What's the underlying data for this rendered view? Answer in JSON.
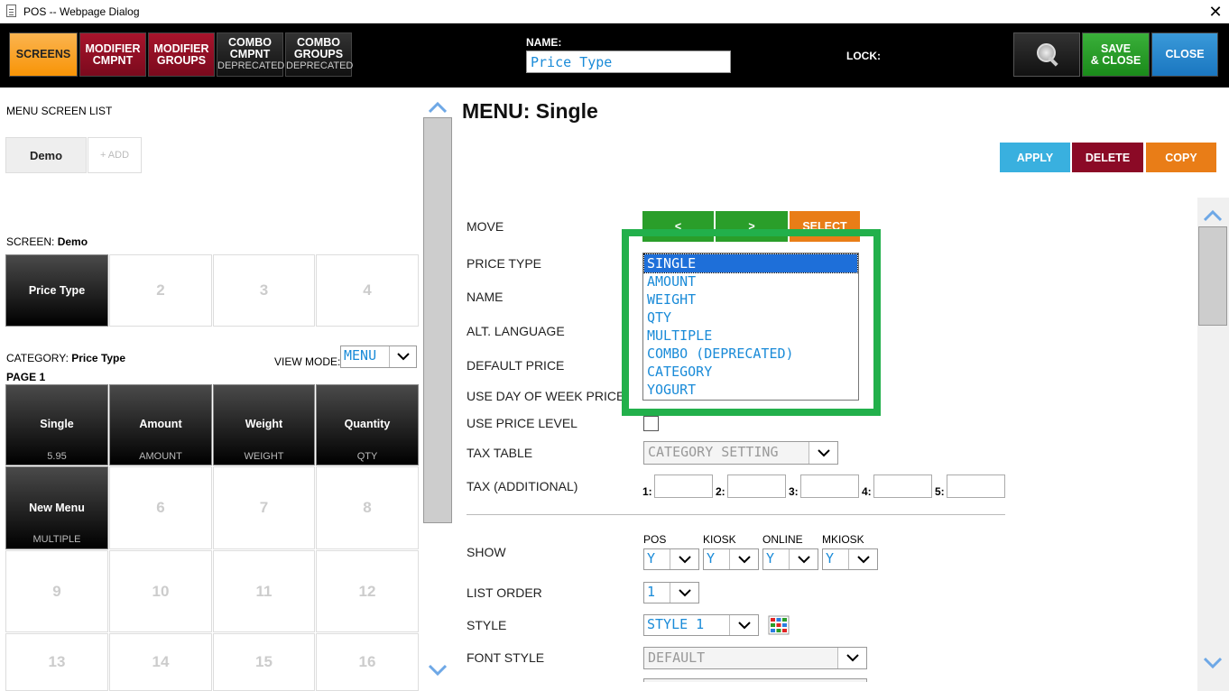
{
  "window": {
    "title": "POS -- Webpage Dialog",
    "close_glyph": "✕"
  },
  "toolbar": {
    "screens": "SCREENS",
    "modifier_cmpnt": [
      "MODIFIER",
      "CMPNT"
    ],
    "modifier_groups": [
      "MODIFIER",
      "GROUPS"
    ],
    "combo_cmpnt": [
      "COMBO",
      "CMPNT",
      "DEPRECATED"
    ],
    "combo_groups": [
      "COMBO",
      "GROUPS",
      "DEPRECATED"
    ],
    "name_label": "NAME:",
    "name_value": "Price Type",
    "lock_label": "LOCK:",
    "search_icon": "search-icon",
    "save_close": [
      "SAVE",
      "& CLOSE"
    ],
    "close": "CLOSE"
  },
  "left": {
    "menu_screen_list_label": "MENU SCREEN LIST",
    "screen_tabs": [
      "Demo"
    ],
    "add_label": "+ ADD",
    "screen_prefix": "SCREEN: ",
    "screen_name": "Demo",
    "screen_cells": [
      "Price Type",
      "2",
      "3",
      "4"
    ],
    "category_prefix": "CATEGORY: ",
    "category_name": "Price Type",
    "view_mode_label": "VIEW MODE:",
    "view_mode_value": "MENU",
    "page_label": "PAGE 1",
    "items": [
      {
        "name": "Single",
        "sub": "5.95"
      },
      {
        "name": "Amount",
        "sub": "AMOUNT"
      },
      {
        "name": "Weight",
        "sub": "WEIGHT"
      },
      {
        "name": "Quantity",
        "sub": "QTY"
      },
      {
        "name": "New Menu",
        "sub": "MULTIPLE"
      },
      {
        "name": "6"
      },
      {
        "name": "7"
      },
      {
        "name": "8"
      },
      {
        "name": "9"
      },
      {
        "name": "10"
      },
      {
        "name": "11"
      },
      {
        "name": "12"
      },
      {
        "name": "13"
      },
      {
        "name": "14"
      },
      {
        "name": "15"
      },
      {
        "name": "16"
      }
    ]
  },
  "right": {
    "menu_title": "MENU: Single",
    "apply": "APPLY",
    "delete": "DELETE",
    "copy": "COPY",
    "labels": {
      "move": "MOVE",
      "price_type": "PRICE TYPE",
      "name": "NAME",
      "alt_language": "ALT. LANGUAGE",
      "default_price": "DEFAULT PRICE",
      "use_dow_price": "USE DAY OF WEEK PRICE",
      "use_price_level": "USE PRICE LEVEL",
      "tax_table": "TAX TABLE",
      "tax_additional": "TAX (ADDITIONAL)",
      "show": "SHOW",
      "list_order": "LIST ORDER",
      "style": "STYLE",
      "font_style": "FONT STYLE"
    },
    "move_left": "<",
    "move_right": ">",
    "select": "SELECT",
    "price_type_options": [
      "SINGLE",
      "AMOUNT",
      "WEIGHT",
      "QTY",
      "MULTIPLE",
      "COMBO (DEPRECATED)",
      "CATEGORY",
      "YOGURT"
    ],
    "price_type_selected": "SINGLE",
    "tax_table_value": "CATEGORY SETTING",
    "tax_slots": [
      "1:",
      "2:",
      "3:",
      "4:",
      "5:"
    ],
    "show_cols": [
      {
        "label": "POS",
        "value": "Y"
      },
      {
        "label": "KIOSK",
        "value": "Y"
      },
      {
        "label": "ONLINE",
        "value": "Y"
      },
      {
        "label": "MKIOSK",
        "value": "Y"
      }
    ],
    "list_order_value": "1",
    "style_value": "STYLE 1",
    "font_style_value": "DEFAULT",
    "highlight_color": "#22b04b"
  }
}
